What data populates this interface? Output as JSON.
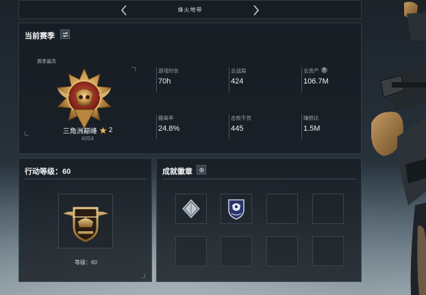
{
  "nav": {
    "title": "烽火地带"
  },
  "season": {
    "title": "当前赛季",
    "title_sub": "",
    "season_high_label": "赛季最高",
    "rank_name": "三角洲巅峰",
    "rank_stars": "2",
    "rank_score": "6054",
    "stats": [
      {
        "label": "游戏时长",
        "value": "70h"
      },
      {
        "label": "总战局",
        "value": "424"
      },
      {
        "label": "总资产",
        "value": "106.7M",
        "help": "?"
      },
      {
        "label": "撤离率",
        "value": "24.8%"
      },
      {
        "label": "击败干员",
        "value": "445"
      },
      {
        "label": "赚损比",
        "value": "1.5M"
      }
    ]
  },
  "level": {
    "title": "行动等级：60",
    "level_label": "等级：60"
  },
  "badges": {
    "title": "成就徽章",
    "title_sub": "",
    "slots": [
      {
        "icon": "diamond-badge-icon",
        "filled": true
      },
      {
        "icon": "shield-badge-icon",
        "filled": true
      },
      {
        "icon": "empty-slot",
        "filled": false
      },
      {
        "icon": "empty-slot",
        "filled": false
      },
      {
        "icon": "empty-slot",
        "filled": false
      },
      {
        "icon": "empty-slot",
        "filled": false
      },
      {
        "icon": "empty-slot",
        "filled": false
      },
      {
        "icon": "empty-slot",
        "filled": false
      }
    ]
  },
  "colors": {
    "panel_bg": "#161c22",
    "gold": "#c8a05a",
    "accent_red": "#8e2a22",
    "text_primary": "#f1f4f6",
    "text_muted": "#98a2ab"
  }
}
